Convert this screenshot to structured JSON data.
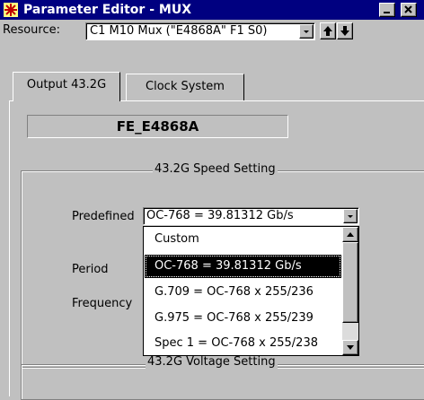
{
  "window": {
    "title": "Parameter Editor - MUX",
    "title_bg": "#000080",
    "icons": {
      "app": "app-asterisk-icon",
      "minimize": "minimize-icon",
      "close": "close-icon"
    }
  },
  "resource": {
    "label": "Resource:",
    "selected": "C1 M10 Mux (\"E4868A\" F1 S0)",
    "icons": {
      "dropdown": "chevron-down-icon",
      "up": "arrow-up-icon",
      "down": "arrow-down-icon"
    }
  },
  "tabs": [
    {
      "label": "Output 43.2G",
      "active": true
    },
    {
      "label": "Clock System",
      "active": false
    }
  ],
  "device_name": "FE_E4868A",
  "speed_setting": {
    "title": "43.2G Speed Setting",
    "predefined_label": "Predefined",
    "predefined_value": "OC-768 = 39.81312 Gb/s",
    "period_label": "Period",
    "frequency_label": "Frequency",
    "options": [
      {
        "label": "Custom",
        "selected": false
      },
      {
        "label": "OC-768 = 39.81312 Gb/s",
        "selected": true
      },
      {
        "label": "G.709  = OC-768 x 255/236",
        "selected": false
      },
      {
        "label": "G.975  = OC-768 x 255/239",
        "selected": false
      },
      {
        "label": "Spec 1 = OC-768 x 255/238",
        "selected": false
      }
    ]
  },
  "voltage_setting": {
    "title": "43.2G Voltage Setting"
  }
}
